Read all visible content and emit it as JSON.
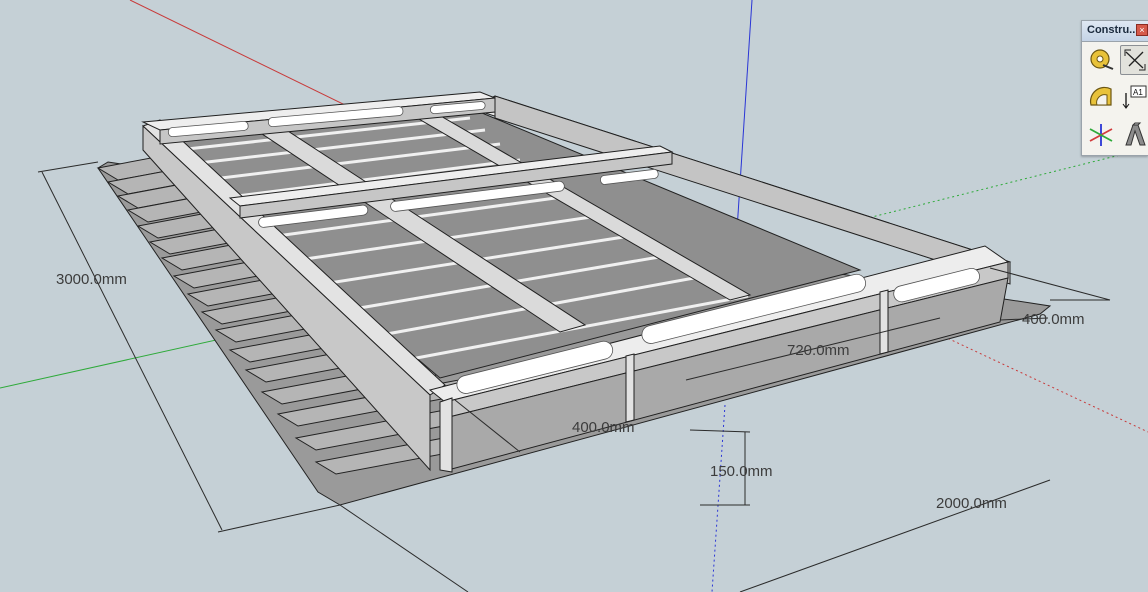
{
  "toolbar": {
    "title": "Constru...",
    "close_glyph": "×",
    "tools": [
      {
        "name": "tape-measure-icon"
      },
      {
        "name": "dimension-icon"
      },
      {
        "name": "protractor-icon"
      },
      {
        "name": "text-icon",
        "glyph": "A1"
      },
      {
        "name": "axes-icon"
      },
      {
        "name": "3d-text-icon",
        "glyph": "A"
      }
    ]
  },
  "dimensions": {
    "length": "3000.0mm",
    "width": "2000.0mm",
    "side_gap": "400.0mm",
    "middle_gap": "720.0mm",
    "front_gap": "400.0mm",
    "height": "150.0mm"
  },
  "colors": {
    "background": "#c5d0d6",
    "red_axis": "#d23c3c",
    "green_axis": "#2eaa3a",
    "blue_axis": "#2a35d6",
    "face_top": "#ececec",
    "face_side": "#c9c9c9",
    "edge": "#202020"
  }
}
